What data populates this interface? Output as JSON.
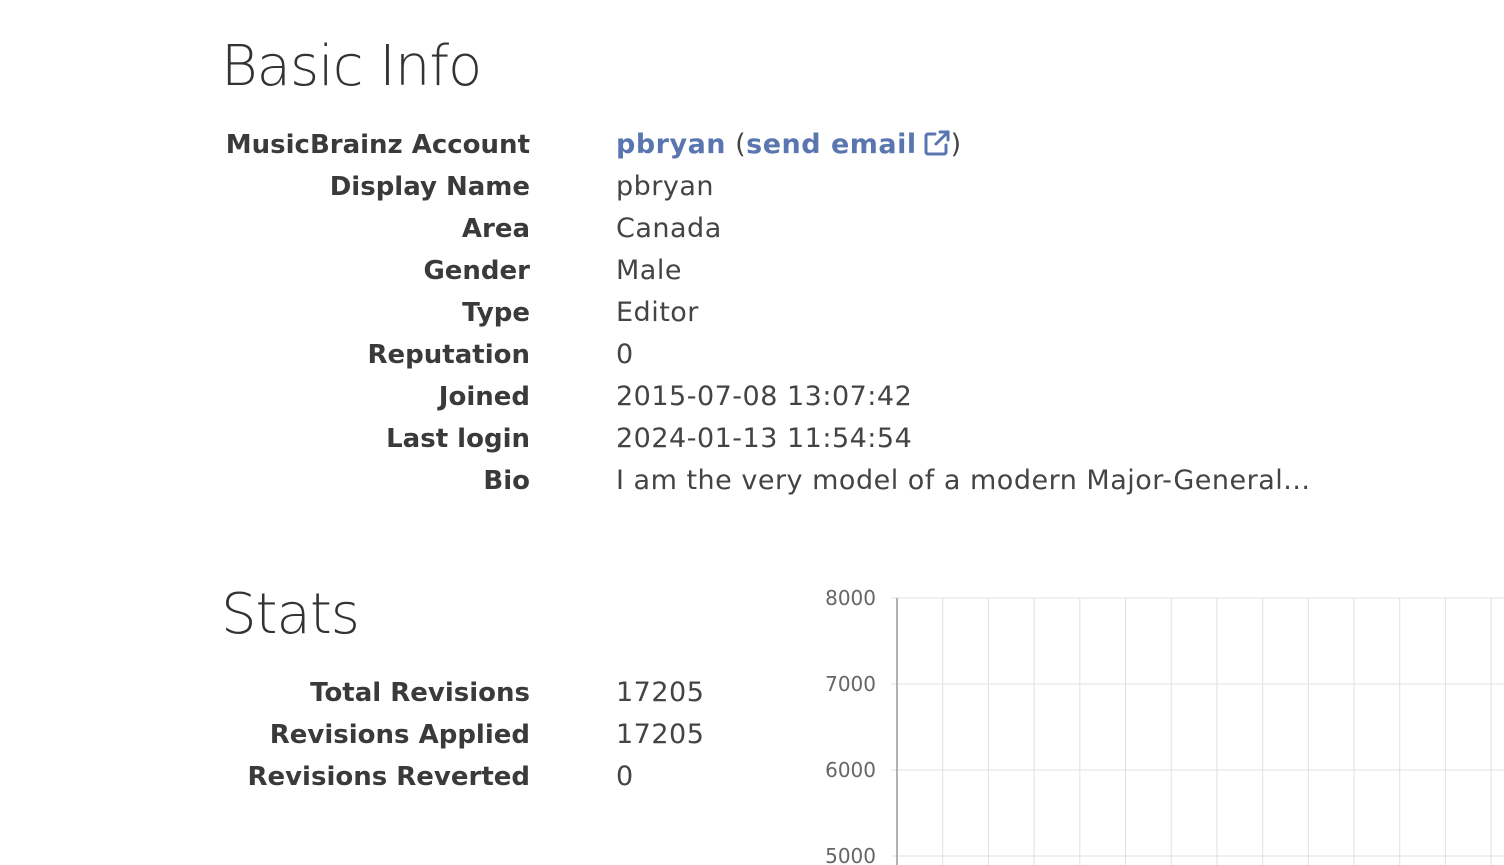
{
  "basic_info": {
    "title": "Basic Info",
    "account": {
      "label": "MusicBrainz Account",
      "username": "pbryan",
      "open_paren": "(",
      "email_link": "send email",
      "close_paren": ")"
    },
    "fields": [
      {
        "label": "Display Name",
        "value": "pbryan"
      },
      {
        "label": "Area",
        "value": "Canada"
      },
      {
        "label": "Gender",
        "value": "Male"
      },
      {
        "label": "Type",
        "value": "Editor"
      },
      {
        "label": "Reputation",
        "value": "0"
      },
      {
        "label": "Joined",
        "value": "2015-07-08 13:07:42"
      },
      {
        "label": "Last login",
        "value": "2024-01-13 11:54:54"
      },
      {
        "label": "Bio",
        "value": "I am the very model of a modern Major-General..."
      }
    ]
  },
  "stats": {
    "title": "Stats",
    "fields": [
      {
        "label": "Total Revisions",
        "value": "17205"
      },
      {
        "label": "Revisions Applied",
        "value": "17205"
      },
      {
        "label": "Revisions Reverted",
        "value": "0"
      }
    ]
  },
  "colors": {
    "link": "#5a76b0",
    "grid": "#e0e0e0",
    "axis": "#999999"
  },
  "chart_data": {
    "type": "line",
    "title": "",
    "xlabel": "",
    "ylabel": "",
    "y_ticks": [
      8000,
      7000,
      6000,
      5000
    ],
    "x_gridline_count": 14,
    "grid": true,
    "series": []
  }
}
